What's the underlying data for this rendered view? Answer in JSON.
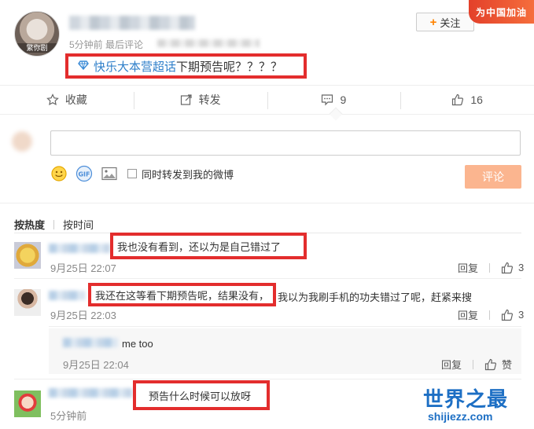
{
  "post": {
    "avatar_label": "繁你剧",
    "time_meta": "5分钟前 最后评论",
    "follow_label": "关注",
    "corner_badge": "为中国加油",
    "topic": "快乐大本营超话",
    "content": "下期预告呢？？？？"
  },
  "actions": {
    "favorite_label": "收藏",
    "repost_label": "转发",
    "comment_count": "9",
    "like_count": "16"
  },
  "composer": {
    "input_value": "",
    "repost_label": "同时转发到我的微博",
    "submit_label": "评论"
  },
  "sort": {
    "hot_label": "按热度",
    "time_label": "按时间"
  },
  "comments": [
    {
      "text": "我也没有看到，还以为是自己错过了",
      "time": "9月25日 22:07",
      "reply_label": "回复",
      "likes": "3"
    },
    {
      "text_highlight": "我还在这等看下期预告呢，结果没有，",
      "text_rest": "我以为我刷手机的功夫错过了呢，赶紧来搜",
      "time": "9月25日 22:03",
      "reply_label": "回复",
      "likes": "3",
      "reply": {
        "text": "me too",
        "time": "9月25日 22:04",
        "reply_label": "回复",
        "like_label": "赞"
      }
    },
    {
      "text": "预告什么时候可以放呀",
      "time": "5分钟前"
    }
  ],
  "watermark": {
    "title": "世界之最",
    "url": "shijiezz.com"
  },
  "colors": {
    "highlight_border": "#e32d2d",
    "topic_link": "#2d7ec9",
    "submit_disabled": "#fbb58f",
    "follow_plus": "#ff8200"
  }
}
